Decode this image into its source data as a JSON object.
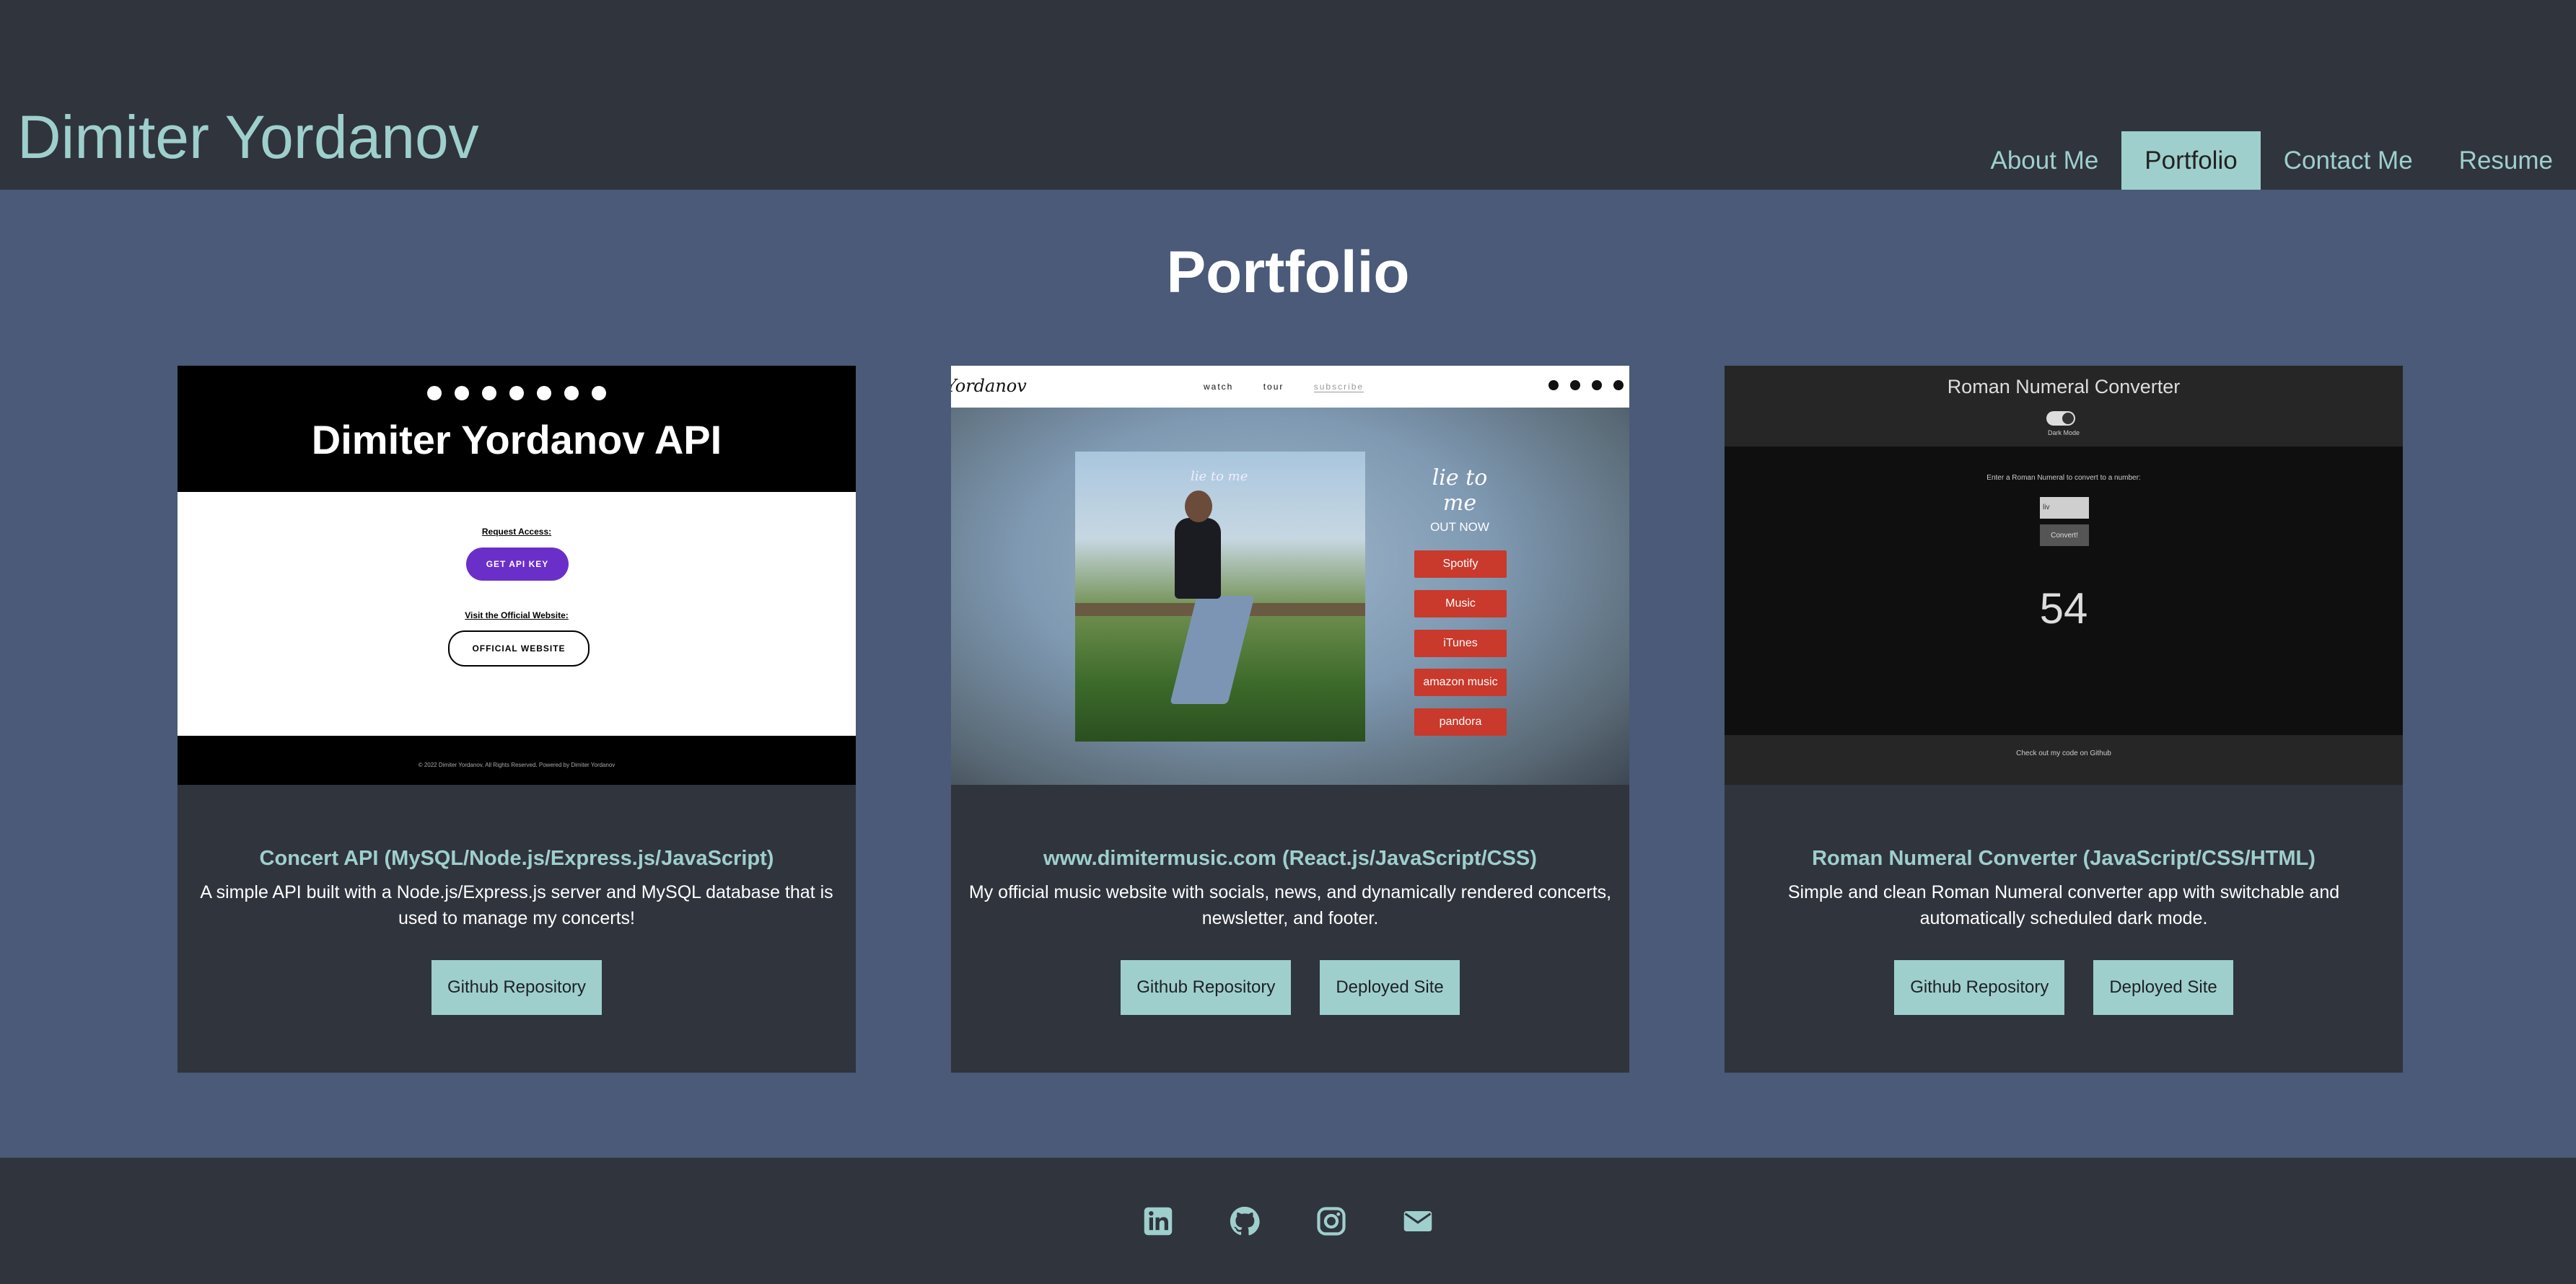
{
  "header": {
    "brand": "Dimiter Yordanov",
    "nav": [
      "About Me",
      "Portfolio",
      "Contact Me",
      "Resume"
    ],
    "active": "Portfolio"
  },
  "main": {
    "title": "Portfolio",
    "cards": [
      {
        "title": "Concert API (MySQL/Node.js/Express.js/JavaScript)",
        "description": "A simple API built with a Node.js/Express.js server and MySQL database that is used to manage my concerts!",
        "buttons": [
          "Github Repository"
        ],
        "preview": {
          "heading": "Dimiter Yordanov API",
          "request_label": "Request Access:",
          "api_button": "GET API KEY",
          "visit_label": "Visit the Official Website:",
          "site_button": "OFFICIAL WEBSITE",
          "footer": "© 2022 Dimiter Yordanov. All Rights Reserved. Powered by Dimiter Yordanov"
        }
      },
      {
        "title": "www.dimitermusic.com (React.js/JavaScript/CSS)",
        "description": "My official music website with socials, news, and dynamically rendered concerts, newsletter, and footer.",
        "buttons": [
          "Github Repository",
          "Deployed Site"
        ],
        "preview": {
          "logo": "Yordanov",
          "menu": [
            "watch",
            "tour",
            "subscribe"
          ],
          "album_script": "lie to me",
          "side_title": "lie to me",
          "side_sub": "OUT NOW",
          "stores": [
            "Spotify",
            "Music",
            "iTunes",
            "amazon music",
            "pandora"
          ]
        }
      },
      {
        "title": "Roman Numeral Converter (JavaScript/CSS/HTML)",
        "description": "Simple and clean Roman Numeral converter app with switchable and automatically scheduled dark mode.",
        "buttons": [
          "Github Repository",
          "Deployed Site"
        ],
        "preview": {
          "app_title": "Roman Numeral Converter",
          "dark_mode": "Dark Mode",
          "prompt": "Enter a Roman Numeral to convert to a number:",
          "input_value": "liv",
          "convert": "Convert!",
          "result": "54",
          "footer": "Check out my code on Github"
        }
      }
    ]
  },
  "footer": {
    "icons": [
      "linkedin-icon",
      "github-icon",
      "instagram-icon",
      "email-icon"
    ]
  },
  "colors": {
    "accent": "#9ecfcc",
    "header_bg": "#30343d",
    "main_bg": "#4a5a78"
  }
}
